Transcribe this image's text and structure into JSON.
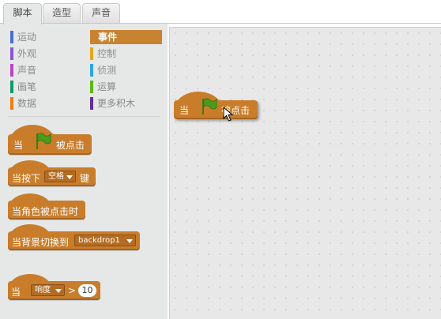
{
  "tabs": [
    {
      "label": "脚本",
      "active": true
    },
    {
      "label": "造型",
      "active": false
    },
    {
      "label": "声音",
      "active": false
    }
  ],
  "categories": [
    {
      "label": "运动",
      "color": "#4a6cd4"
    },
    {
      "label": "事件",
      "color": "#c88330",
      "selected": true
    },
    {
      "label": "外观",
      "color": "#8a55d7"
    },
    {
      "label": "控制",
      "color": "#e1a91a"
    },
    {
      "label": "声音",
      "color": "#bb42c3"
    },
    {
      "label": "侦测",
      "color": "#2ca5e2"
    },
    {
      "label": "画笔",
      "color": "#0e9a6c"
    },
    {
      "label": "运算",
      "color": "#5cb712"
    },
    {
      "label": "数据",
      "color": "#ee7d16"
    },
    {
      "label": "更多积木",
      "color": "#632d99"
    }
  ],
  "palette_blocks": {
    "flag_prefix": "当",
    "flag_suffix": "被点击",
    "key_prefix": "当按下",
    "key_value": "空格",
    "key_suffix": "键",
    "sprite_clicked": "当角色被点击时",
    "backdrop_prefix": "当背景切换到",
    "backdrop_value": "backdrop1",
    "sensor_prefix": "当",
    "sensor_value": "响度",
    "sensor_op": ">",
    "sensor_number": "10"
  },
  "script_area": {
    "flag_prefix": "当",
    "flag_suffix": "被点击"
  },
  "colors": {
    "events_block": "#c97d2b",
    "flag_green": "#4c9a1c"
  }
}
